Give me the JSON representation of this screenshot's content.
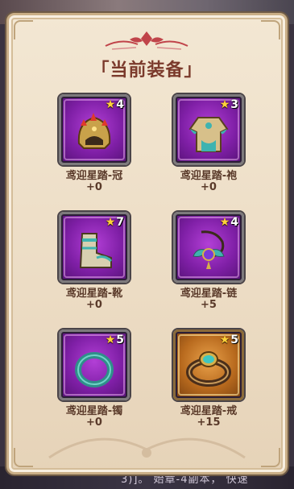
{
  "title": "「当前装备」",
  "bottom_bar": {
    "text": "3)]。 始章-4副本， 快速"
  },
  "equipment": [
    {
      "name": "鸢迎星踏-冠",
      "level": "+0",
      "stars": "4",
      "rarity": "purple",
      "icon": "helmet-icon"
    },
    {
      "name": "鸢迎星踏-袍",
      "level": "+0",
      "stars": "3",
      "rarity": "purple",
      "icon": "robe-icon"
    },
    {
      "name": "鸢迎星踏-靴",
      "level": "+0",
      "stars": "7",
      "rarity": "purple",
      "icon": "boots-icon"
    },
    {
      "name": "鸢迎星踏-链",
      "level": "+5",
      "stars": "4",
      "rarity": "purple",
      "icon": "necklace-icon"
    },
    {
      "name": "鸢迎星踏-镯",
      "level": "+0",
      "stars": "5",
      "rarity": "purple",
      "icon": "bracelet-icon"
    },
    {
      "name": "鸢迎星踏-戒",
      "level": "+15",
      "stars": "5",
      "rarity": "orange",
      "icon": "ring-icon"
    }
  ],
  "colors": {
    "purple_frame": "#7f1fa6",
    "orange_frame": "#b86a1e",
    "title": "#7b3a2c",
    "panel": "#ecdcc4"
  }
}
